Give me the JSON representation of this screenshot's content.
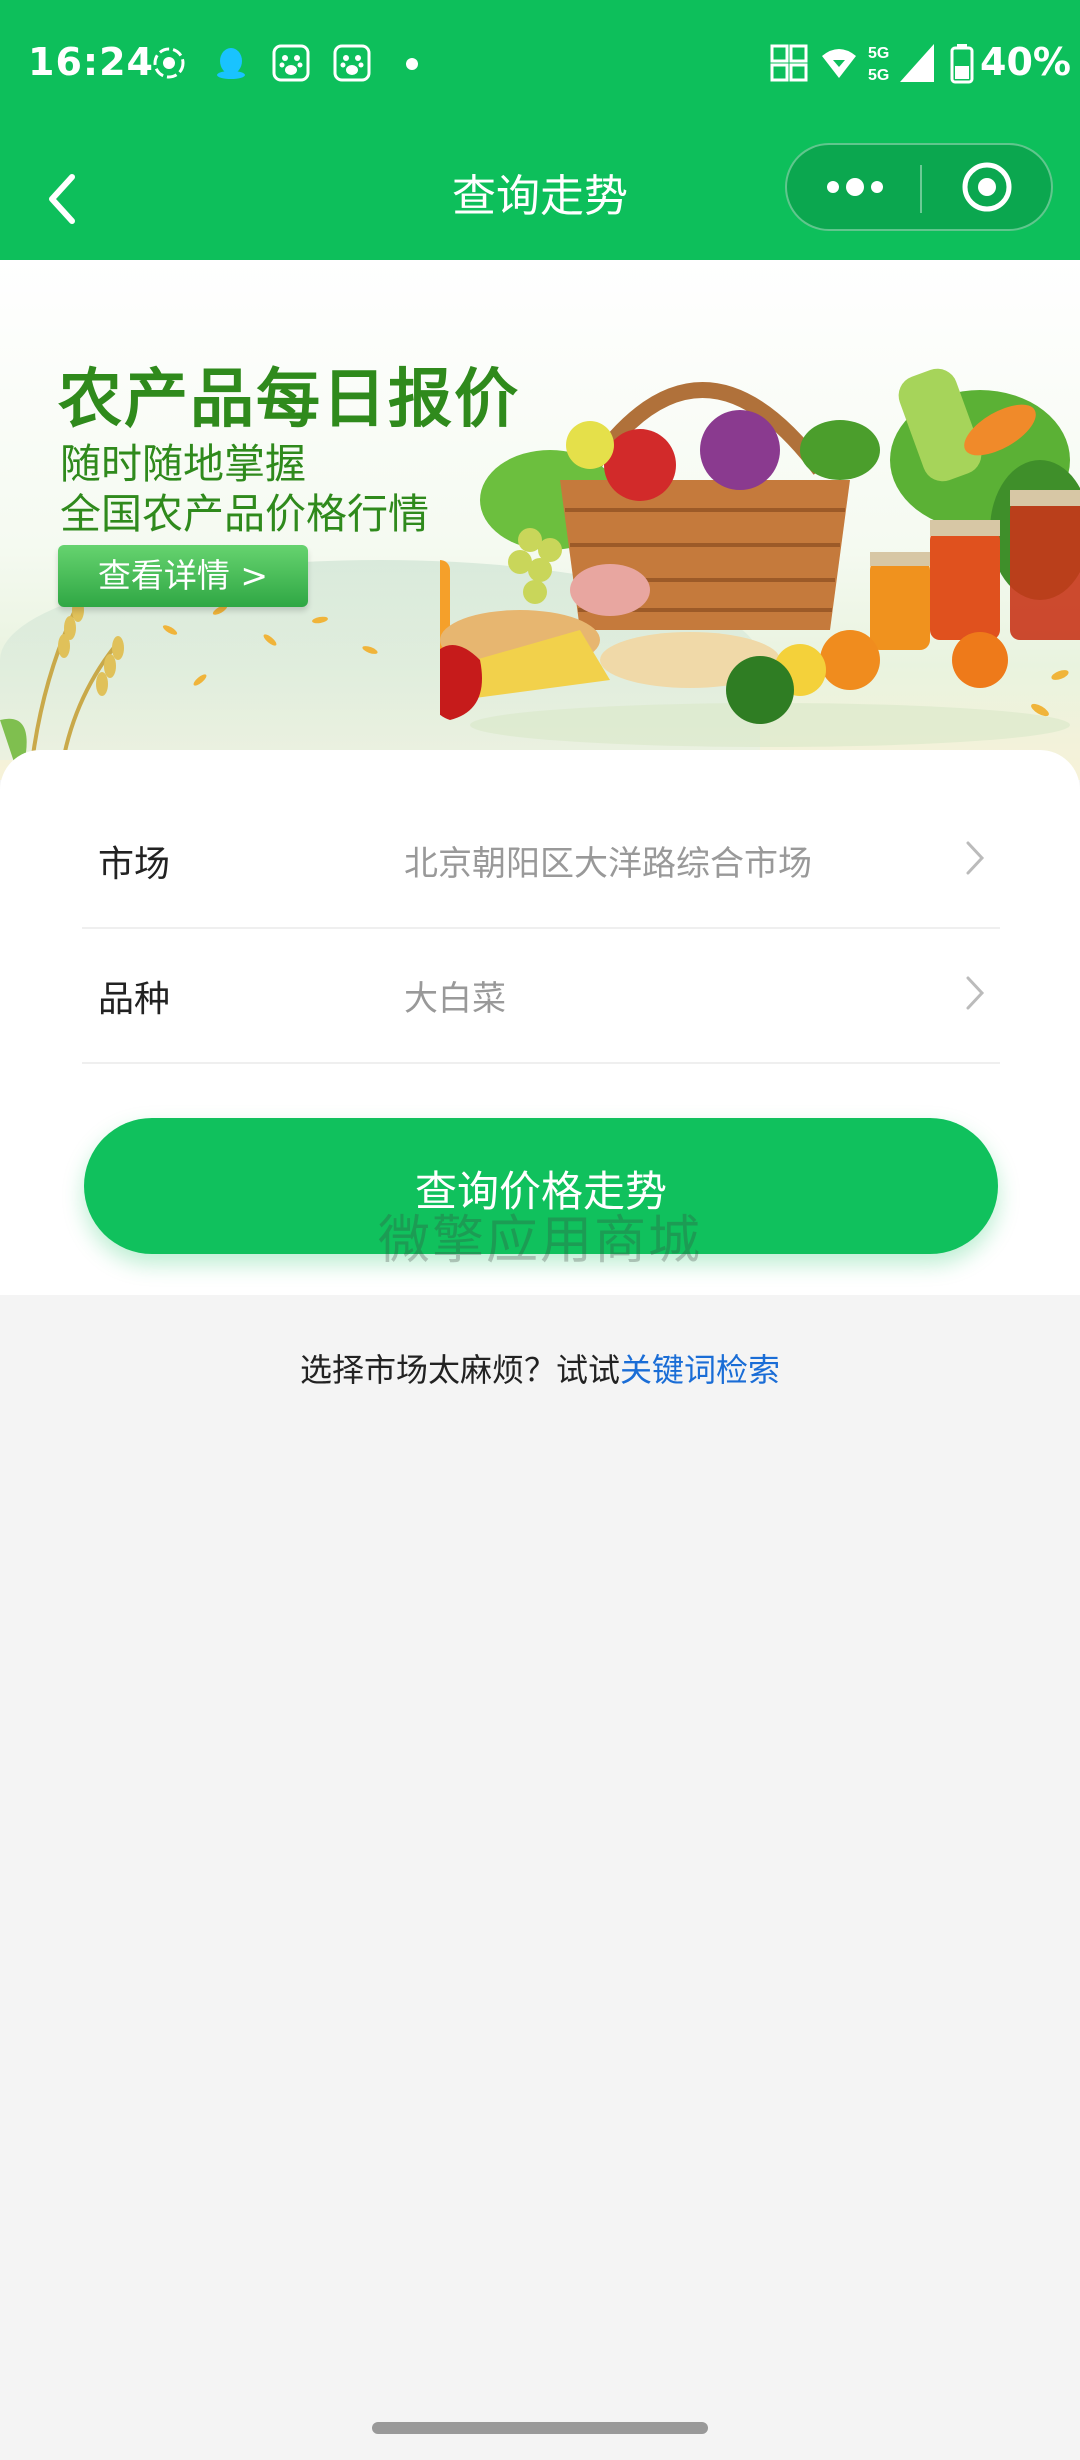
{
  "status_bar": {
    "time": "16:24",
    "battery": "40%",
    "icons": [
      "screen-record-icon",
      "qq-icon",
      "baidu-icon",
      "baidu-icon",
      "nfc-icon",
      "wifi-icon",
      "signal-5g-icon",
      "battery-icon"
    ]
  },
  "nav": {
    "title": "查询走势",
    "back_icon": "chevron-left-icon",
    "more_icon": "more-dots-icon",
    "close_icon": "target-icon"
  },
  "banner": {
    "title": "农产品每日报价",
    "subtitle_line1": "随时随地掌握",
    "subtitle_line2": "全国农产品价格行情",
    "button_label": "查看详情 >"
  },
  "form": {
    "market_label": "市场",
    "market_value": "北京朝阳区大洋路综合市场",
    "variety_label": "品种",
    "variety_value": "大白菜",
    "submit_label": "查询价格走势"
  },
  "watermark": "微擎应用商城",
  "hint": {
    "prefix": "选择市场太麻烦？试试",
    "link": "关键词检索"
  },
  "colors": {
    "primary": "#0dbf5b",
    "link": "#1a6dd6",
    "banner_text": "#2f8a1c"
  }
}
